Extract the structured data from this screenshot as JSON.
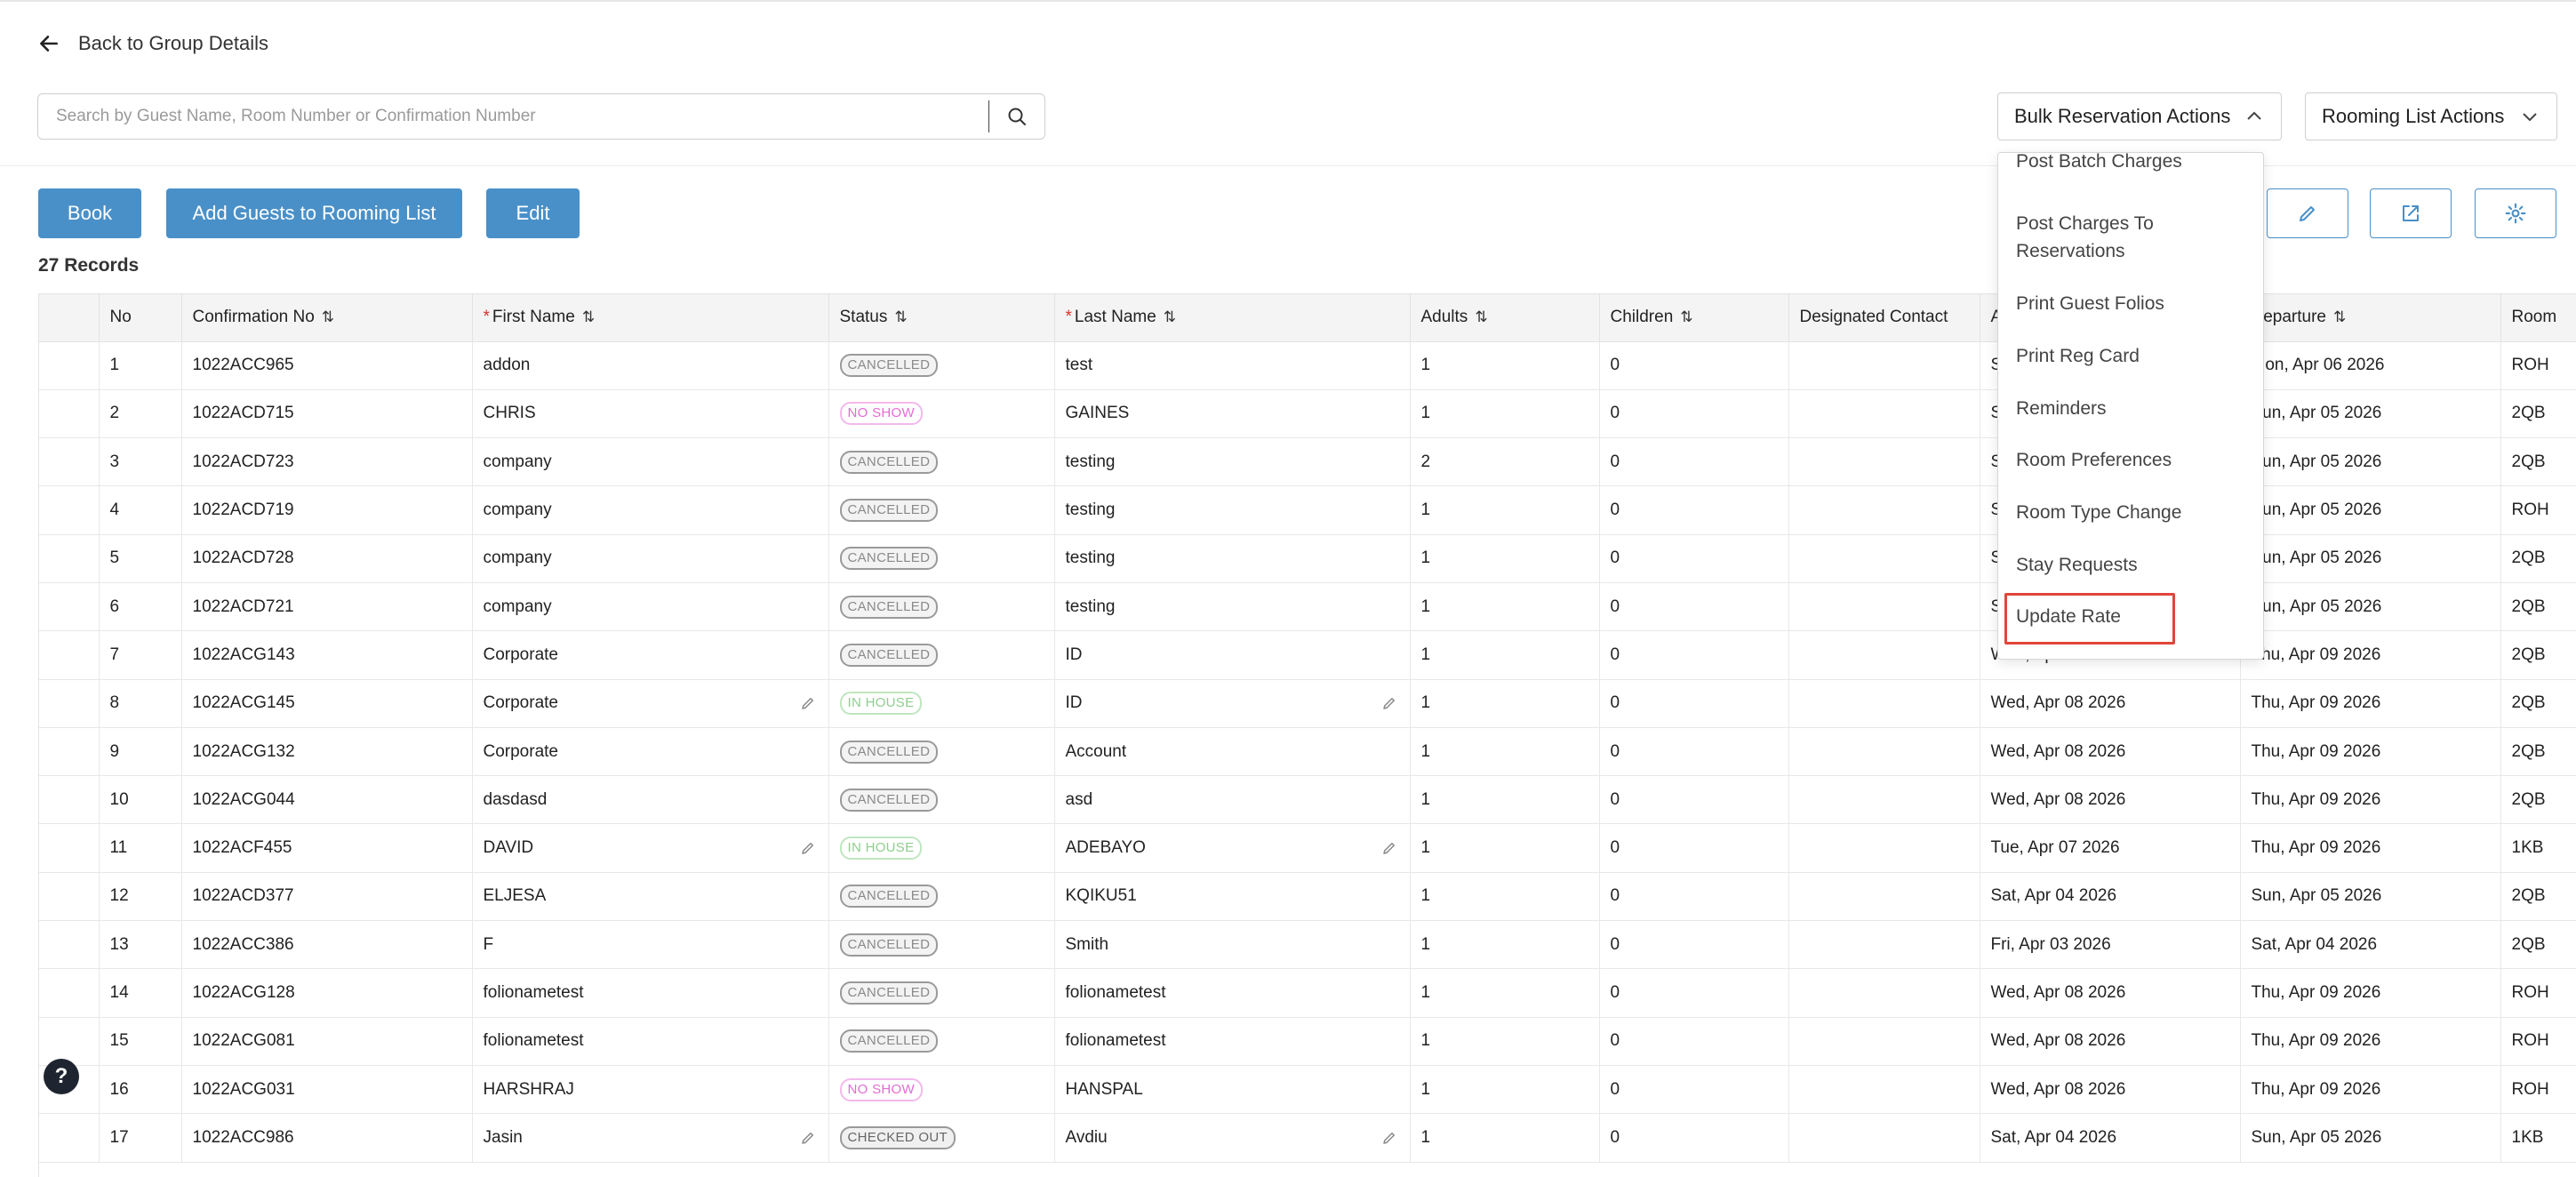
{
  "nav": {
    "back_label": "Back to Group Details"
  },
  "search": {
    "placeholder": "Search by Guest Name, Room Number or Confirmation Number"
  },
  "dropdowns": {
    "bulk_label": "Bulk Reservation Actions",
    "rooming_label": "Rooming List Actions"
  },
  "toolbar": {
    "book_label": "Book",
    "add_guests_label": "Add Guests to Rooming List",
    "edit_label": "Edit"
  },
  "records_label": "27 Records",
  "table": {
    "columns": [
      "",
      "No",
      "Confirmation No",
      "First Name",
      "Status",
      "Last Name",
      "Adults",
      "Children",
      "Designated Contact",
      "A",
      "Departure",
      "Room"
    ],
    "rows": [
      {
        "no": "1",
        "conf": "1022ACC965",
        "first": "addon",
        "status": "CANCELLED",
        "last": "test",
        "adults": "1",
        "children": "0",
        "arrival": "S",
        "departure": "Mon, Apr 06 2026",
        "room": "ROH"
      },
      {
        "no": "2",
        "conf": "1022ACD715",
        "first": "CHRIS",
        "status": "NO SHOW",
        "last": "GAINES",
        "adults": "1",
        "children": "0",
        "arrival": "S",
        "departure": "Sun, Apr 05 2026",
        "room": "2QB"
      },
      {
        "no": "3",
        "conf": "1022ACD723",
        "first": "company",
        "status": "CANCELLED",
        "last": "testing",
        "adults": "2",
        "children": "0",
        "arrival": "S",
        "departure": "Sun, Apr 05 2026",
        "room": "2QB"
      },
      {
        "no": "4",
        "conf": "1022ACD719",
        "first": "company",
        "status": "CANCELLED",
        "last": "testing",
        "adults": "1",
        "children": "0",
        "arrival": "S",
        "departure": "Sun, Apr 05 2026",
        "room": "ROH"
      },
      {
        "no": "5",
        "conf": "1022ACD728",
        "first": "company",
        "status": "CANCELLED",
        "last": "testing",
        "adults": "1",
        "children": "0",
        "arrival": "S",
        "departure": "Sun, Apr 05 2026",
        "room": "2QB"
      },
      {
        "no": "6",
        "conf": "1022ACD721",
        "first": "company",
        "status": "CANCELLED",
        "last": "testing",
        "adults": "1",
        "children": "0",
        "arrival": "S",
        "departure": "Sun, Apr 05 2026",
        "room": "2QB"
      },
      {
        "no": "7",
        "conf": "1022ACG143",
        "first": "Corporate",
        "status": "CANCELLED",
        "last": "ID",
        "adults": "1",
        "children": "0",
        "arrival": "Wed, Apr 08 2026",
        "departure": "Thu, Apr 09 2026",
        "room": "2QB"
      },
      {
        "no": "8",
        "conf": "1022ACG145",
        "first": "Corporate",
        "status": "IN HOUSE",
        "last": "ID",
        "adults": "1",
        "children": "0",
        "arrival": "Wed, Apr 08 2026",
        "departure": "Thu, Apr 09 2026",
        "room": "2QB"
      },
      {
        "no": "9",
        "conf": "1022ACG132",
        "first": "Corporate",
        "status": "CANCELLED",
        "last": "Account",
        "adults": "1",
        "children": "0",
        "arrival": "Wed, Apr 08 2026",
        "departure": "Thu, Apr 09 2026",
        "room": "2QB"
      },
      {
        "no": "10",
        "conf": "1022ACG044",
        "first": "dasdasd",
        "status": "CANCELLED",
        "last": "asd",
        "adults": "1",
        "children": "0",
        "arrival": "Wed, Apr 08 2026",
        "departure": "Thu, Apr 09 2026",
        "room": "2QB"
      },
      {
        "no": "11",
        "conf": "1022ACF455",
        "first": "DAVID",
        "status": "IN HOUSE",
        "last": "ADEBAYO",
        "adults": "1",
        "children": "0",
        "arrival": "Tue, Apr 07 2026",
        "departure": "Thu, Apr 09 2026",
        "room": "1KB"
      },
      {
        "no": "12",
        "conf": "1022ACD377",
        "first": "ELJESA",
        "status": "CANCELLED",
        "last": "KQIKU51",
        "adults": "1",
        "children": "0",
        "arrival": "Sat, Apr 04 2026",
        "departure": "Sun, Apr 05 2026",
        "room": "2QB"
      },
      {
        "no": "13",
        "conf": "1022ACC386",
        "first": "F",
        "status": "CANCELLED",
        "last": "Smith",
        "adults": "1",
        "children": "0",
        "arrival": "Fri, Apr 03 2026",
        "departure": "Sat, Apr 04 2026",
        "room": "2QB"
      },
      {
        "no": "14",
        "conf": "1022ACG128",
        "first": "folionametest",
        "status": "CANCELLED",
        "last": "folionametest",
        "adults": "1",
        "children": "0",
        "arrival": "Wed, Apr 08 2026",
        "departure": "Thu, Apr 09 2026",
        "room": "ROH"
      },
      {
        "no": "15",
        "conf": "1022ACG081",
        "first": "folionametest",
        "status": "CANCELLED",
        "last": "folionametest",
        "adults": "1",
        "children": "0",
        "arrival": "Wed, Apr 08 2026",
        "departure": "Thu, Apr 09 2026",
        "room": "ROH"
      },
      {
        "no": "16",
        "conf": "1022ACG031",
        "first": "HARSHRAJ",
        "status": "NO SHOW",
        "last": "HANSPAL",
        "adults": "1",
        "children": "0",
        "arrival": "Wed, Apr 08 2026",
        "departure": "Thu, Apr 09 2026",
        "room": "ROH"
      },
      {
        "no": "17",
        "conf": "1022ACC986",
        "first": "Jasin",
        "status": "CHECKED OUT",
        "last": "Avdiu",
        "adults": "1",
        "children": "0",
        "arrival": "Sat, Apr 04 2026",
        "departure": "Sun, Apr 05 2026",
        "room": "1KB"
      }
    ]
  },
  "bulk_menu": {
    "items": [
      "Post Batch Charges",
      "Post Charges To",
      "Reservations",
      "Print Guest Folios",
      "Print Reg Card",
      "Reminders",
      "Room Preferences",
      "Room Type Change",
      "Stay Requests",
      "Update Rate"
    ]
  },
  "help_label": "?",
  "colors": {
    "primary": "#4a90c8",
    "highlight": "#e0453a"
  }
}
